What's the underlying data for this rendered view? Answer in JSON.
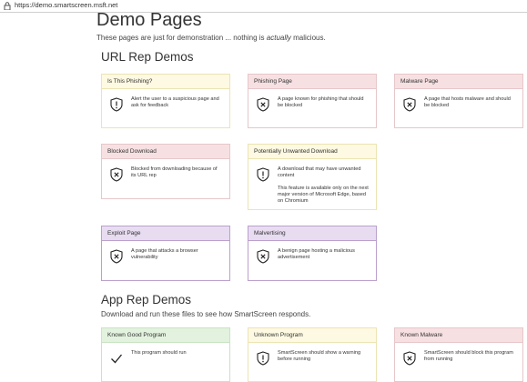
{
  "address_bar": {
    "url": "https://demo.smartscreen.msft.net"
  },
  "page": {
    "title": "Demo Pages",
    "subtitle_pre": "These pages are just for demonstration ... nothing is ",
    "subtitle_em": "actually",
    "subtitle_post": " malicious."
  },
  "url_rep": {
    "heading": "URL Rep Demos",
    "cards": [
      {
        "title": "Is This Phishing?",
        "desc": "Alert the user to a suspicious page and ask for feedback",
        "icon": "shield-exclamation-icon",
        "color": "#fdf9e2"
      },
      {
        "title": "Phishing Page",
        "desc": "A page known for phishing that should be blocked",
        "icon": "shield-x-icon",
        "color": "#f7e0e2"
      },
      {
        "title": "Malware Page",
        "desc": "A page that hosts malware and should be blocked",
        "icon": "shield-x-icon",
        "color": "#f7e0e2"
      },
      {
        "title": "Blocked Download",
        "desc": "Blocked from downloading because of its URL rep",
        "icon": "shield-x-icon",
        "color": "#f7e0e2"
      },
      {
        "title": "Potentially Unwanted Download",
        "desc": "A download that may have unwanted content",
        "desc_extra": "This feature is available only on the next major version of Microsoft Edge, based on Chromium",
        "icon": "shield-exclamation-icon",
        "color": "#fdf9e2"
      },
      {
        "title": "Exploit Page",
        "desc": "A page that attacks a browser vulnerability",
        "icon": "shield-x-icon",
        "color": "#e8dcf1"
      },
      {
        "title": "Malvertising",
        "desc": "A benign page hosting a malicious advertisement",
        "icon": "shield-x-icon",
        "color": "#e8dcf1"
      }
    ]
  },
  "app_rep": {
    "heading": "App Rep Demos",
    "subtitle": "Download and run these files to see how SmartScreen responds.",
    "cards": [
      {
        "title": "Known Good Program",
        "desc": "This program should run",
        "icon": "checkmark-icon",
        "color": "#e2f2de"
      },
      {
        "title": "Unknown Program",
        "desc": "SmartScreen should show a warning before running",
        "icon": "shield-exclamation-icon",
        "color": "#fdf9e2"
      },
      {
        "title": "Known Malware",
        "desc": "SmartScreen should block this program from running",
        "icon": "shield-x-icon",
        "color": "#f7e0e2"
      }
    ]
  }
}
